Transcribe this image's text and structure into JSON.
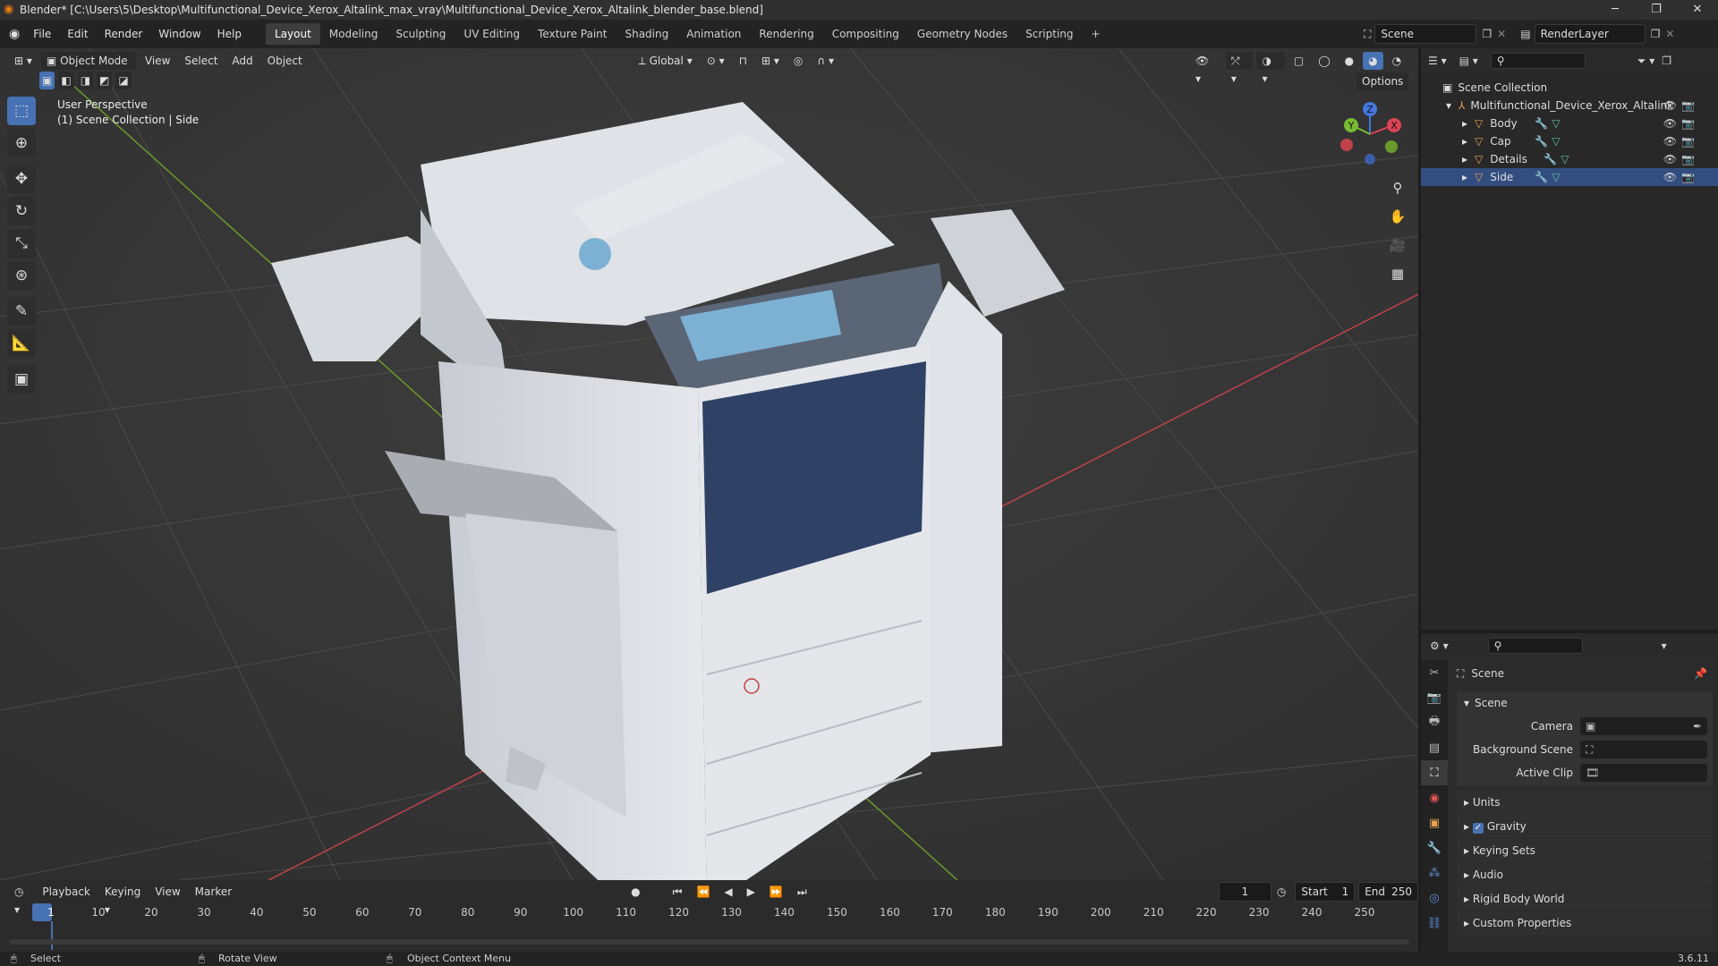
{
  "window": {
    "title": "Blender* [C:\\Users\\5\\Desktop\\Multifunctional_Device_Xerox_Altalink_max_vray\\Multifunctional_Device_Xerox_Altalink_blender_base.blend]",
    "controls": [
      "─",
      "❐",
      "✕"
    ]
  },
  "menus": [
    "File",
    "Edit",
    "Render",
    "Window",
    "Help"
  ],
  "workspaces": [
    "Layout",
    "Modeling",
    "Sculpting",
    "UV Editing",
    "Texture Paint",
    "Shading",
    "Animation",
    "Rendering",
    "Compositing",
    "Geometry Nodes",
    "Scripting"
  ],
  "active_workspace": "Layout",
  "scene_selector": {
    "label": "Scene",
    "icon": "scene-icon"
  },
  "view_layer": {
    "label": "RenderLayer",
    "icon": "view-layer-icon"
  },
  "viewport": {
    "mode": "Object Mode",
    "menus": [
      "View",
      "Select",
      "Add",
      "Object"
    ],
    "transform_orientation": "Global",
    "options_label": "Options",
    "overlay_line1": "User Perspective",
    "overlay_line2": "(1) Scene Collection | Side",
    "tools": [
      "select-box-icon",
      "cursor-icon",
      "move-icon",
      "rotate-icon",
      "scale-icon",
      "transform-icon",
      "annotate-icon",
      "measure-icon",
      "add-cube-icon"
    ],
    "gizmo_axes": {
      "x": "X",
      "y": "Y",
      "z": "Z"
    },
    "colors": {
      "background": "#393939",
      "grid": "#4a4a4a",
      "x_axis": "#c2424a",
      "y_axis": "#6a9a2a",
      "accent": "#4772b3"
    }
  },
  "outliner": {
    "root": "Scene Collection",
    "collection": "Multifunctional_Device_Xerox_Altalink",
    "objects": [
      "Body",
      "Cap",
      "Details",
      "Side"
    ]
  },
  "properties": {
    "header": "Scene",
    "panel_title": "Scene",
    "fields": [
      {
        "label": "Camera",
        "value": ""
      },
      {
        "label": "Background Scene",
        "value": ""
      },
      {
        "label": "Active Clip",
        "value": ""
      }
    ],
    "subpanels": [
      "Units",
      "Gravity",
      "Keying Sets",
      "Audio",
      "Rigid Body World",
      "Custom Properties"
    ],
    "gravity_checked": true,
    "tabs": [
      "tool-icon",
      "render-icon",
      "output-icon",
      "view-layer-icon",
      "scene-icon",
      "world-icon",
      "object-icon",
      "modifier-icon",
      "particles-icon",
      "physics-icon",
      "constraints-icon"
    ]
  },
  "timeline": {
    "menus": [
      "Playback",
      "Keying",
      "View",
      "Marker"
    ],
    "current_frame": "1",
    "start_label": "Start",
    "start": "1",
    "end_label": "End",
    "end": "250",
    "ticks": [
      "1",
      "10",
      "20",
      "30",
      "40",
      "50",
      "60",
      "70",
      "80",
      "90",
      "100",
      "110",
      "120",
      "130",
      "140",
      "150",
      "160",
      "170",
      "180",
      "190",
      "200",
      "210",
      "220",
      "230",
      "240",
      "250"
    ]
  },
  "statusbar": {
    "select": "Select",
    "rotate": "Rotate View",
    "context": "Object Context Menu",
    "version": "3.6.11"
  }
}
